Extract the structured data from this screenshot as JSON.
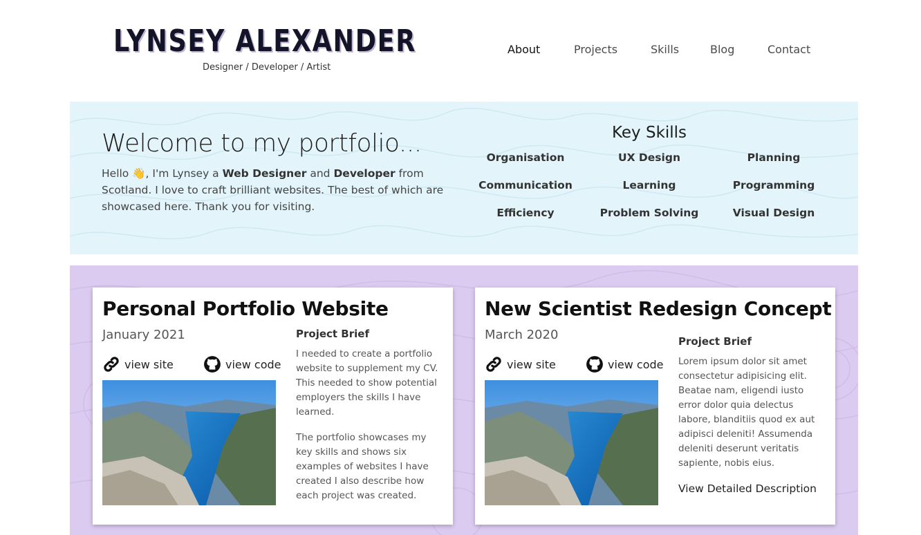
{
  "header": {
    "logo_text": "LYNSEY ALEXANDER",
    "tagline": "Designer / Developer / Artist",
    "nav": [
      "About",
      "Projects",
      "Skills",
      "Blog",
      "Contact"
    ],
    "active_nav": "About"
  },
  "hero": {
    "title": "Welcome to my portfolio...",
    "intro_hello": "Hello",
    "intro_wave_icon": "waving-hand-emoji",
    "intro_part1": ", I'm Lynsey a",
    "intro_bold1": "Web Designer",
    "intro_and": "and",
    "intro_bold2": "Developer",
    "intro_part2": "from Scotland. I love to craft brilliant websites. The best of which are showcased here. Thank you for visiting.",
    "background_color": "#e3f5fb"
  },
  "skills": {
    "title": "Key Skills",
    "items": [
      "Organisation",
      "UX Design",
      "Planning",
      "Communication",
      "Learning",
      "Programming",
      "Efficiency",
      "Problem Solving",
      "Visual Design"
    ]
  },
  "projects": {
    "background_color": "#dccbf0",
    "cards": [
      {
        "title": "Personal Portfolio Website",
        "date": "January 2021",
        "view_site": "view site",
        "view_code": "view code",
        "brief_heading": "Project Brief",
        "brief_paragraphs": [
          "I needed to create a portfolio website to supplement my CV. This needed to show potential employers the skills I have learned.",
          "The portfolio showcases my key skills and shows six examples of websites I have created I also describe how each project was created."
        ]
      },
      {
        "title": "New Scientist Redesign Concept",
        "date": "March 2020",
        "view_site": "view site",
        "view_code": "view code",
        "brief_heading": "Project Brief",
        "brief_paragraphs": [
          "Lorem ipsum dolor sit amet consectetur adipisicing elit. Beatae nam, eligendi iusto error dolor quia delectus labore, blanditiis quod ex aut adipisci deleniti! Assumenda deleniti deserunt veritatis sapiente, nobis eius."
        ],
        "detail_link": "View Detailed Description"
      }
    ]
  },
  "icons": {
    "link": "link-icon",
    "github": "github-icon",
    "image": "fjord-landscape-image"
  }
}
